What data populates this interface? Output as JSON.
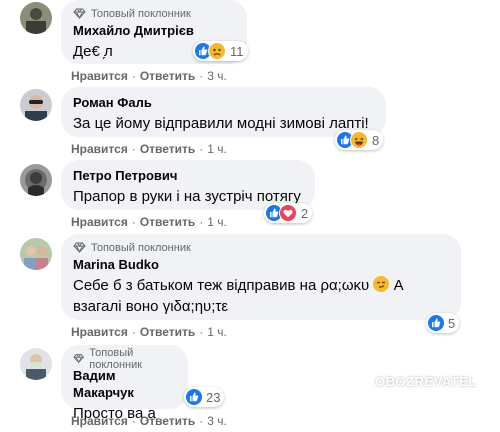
{
  "badge_label": "Топовый поклонник",
  "comments": [
    {
      "name": "Михайло Дмитрієв",
      "text": "Де€ ̗л",
      "badge": true,
      "reaction_count": "11",
      "like": "Нравится",
      "reply": "Ответить",
      "time": "3 ч."
    },
    {
      "name": "Роман Фаль",
      "text": "За це йому відправили модні зимові лапті!",
      "badge": false,
      "reaction_count": "8",
      "like": "Нравится",
      "reply": "Ответить",
      "time": "1 ч."
    },
    {
      "name": "Петро Петрович",
      "text": "Прапор в руки і на зустріч потягу",
      "badge": false,
      "reaction_count": "2",
      "like": "Нравится",
      "reply": "Ответить",
      "time": "1 ч."
    },
    {
      "name": "Marina Budko",
      "text_line1": "Себе б з батьком теж відправив на ρα;ωκυ",
      "text_line1_tail": "А",
      "text_line2": "взагалі воно γιδα;ηυ;τε",
      "badge": true,
      "reaction_count": "5",
      "like": "Нравится",
      "reply": "Ответить",
      "time": "1 ч."
    },
    {
      "name": "Вадим Макарчук",
      "text": "Просто ва ̗а",
      "badge": true,
      "reaction_count": "23",
      "like": "Нравится",
      "reply": "Ответить",
      "time": "3 ч."
    }
  ],
  "watermark": "OBOZREVATEL",
  "colors": {
    "like_blue": "#1877f2",
    "haha_yellow": "#f7b928",
    "love_red": "#f33e58",
    "bubble": "#f0f2f5",
    "meta_gray": "#65676b"
  }
}
